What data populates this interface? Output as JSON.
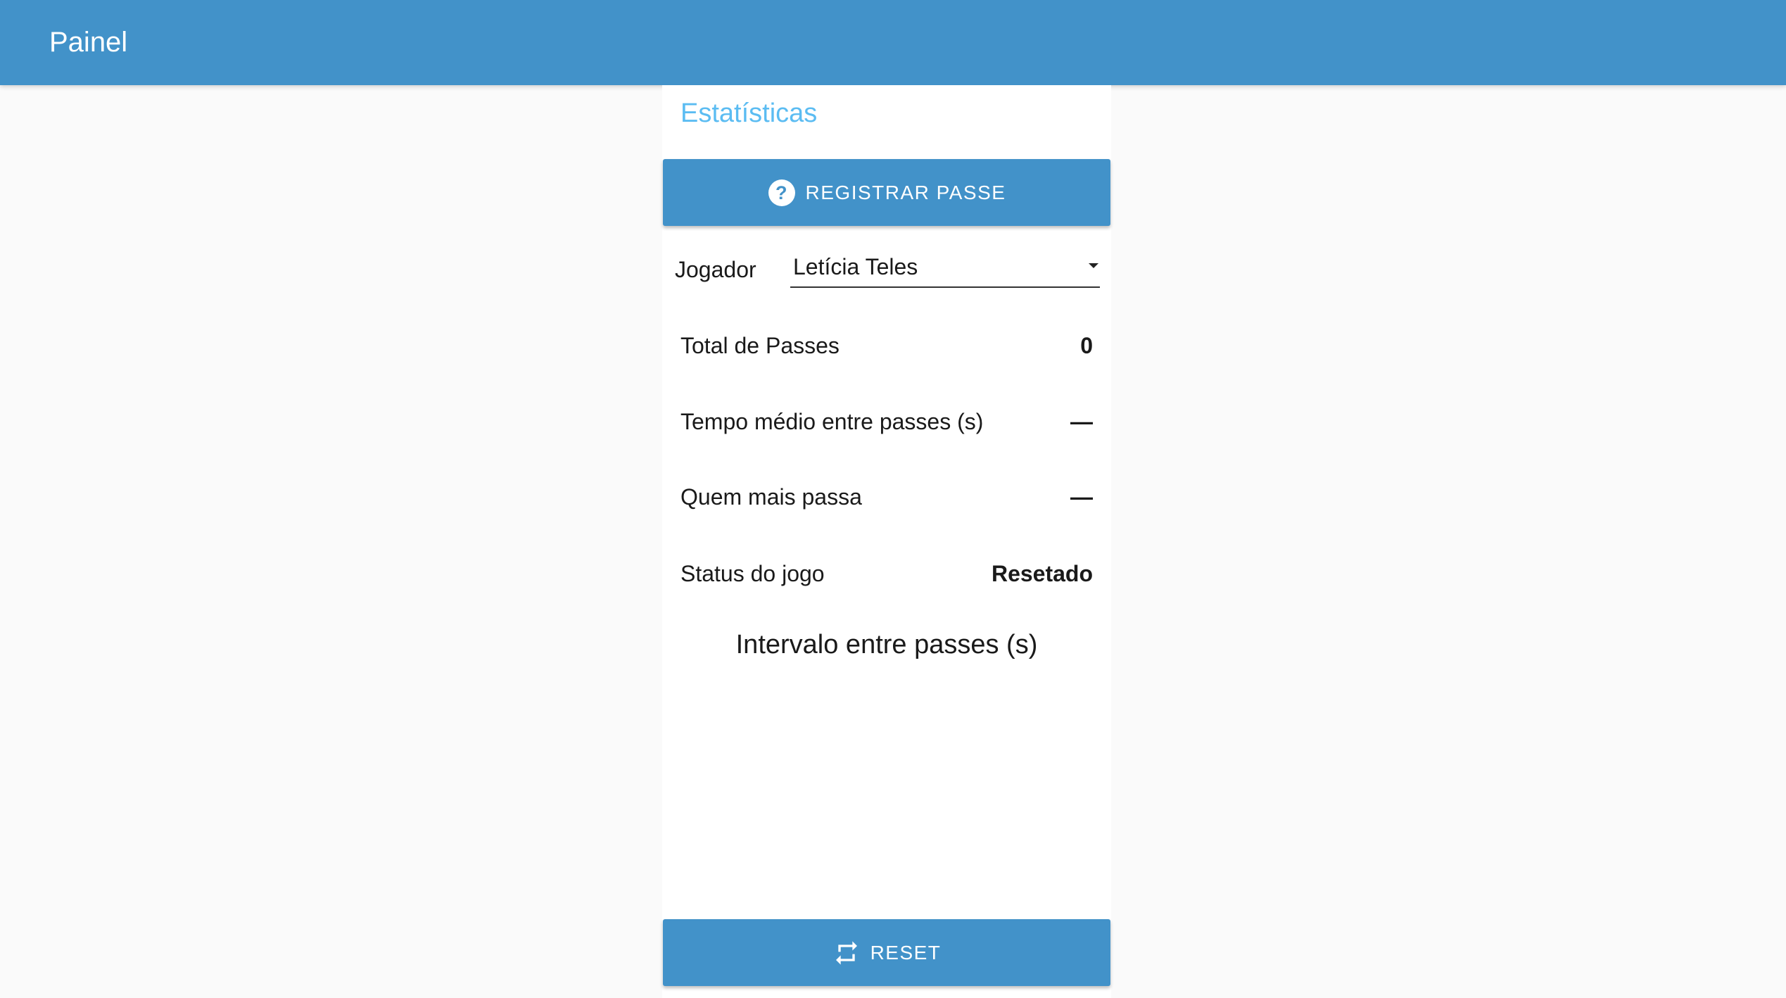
{
  "appbar": {
    "title": "Painel"
  },
  "panel": {
    "title": "Estatísticas",
    "register_button": {
      "label": "REGISTRAR PASSE",
      "icon": "help-circle-icon"
    },
    "player": {
      "label": "Jogador",
      "selected": "Letícia Teles"
    },
    "stats": [
      {
        "label": "Total de Passes",
        "value": "0"
      },
      {
        "label": "Tempo médio entre passes (s)",
        "value": "—"
      },
      {
        "label": "Quem mais passa",
        "value": "—"
      },
      {
        "label": "Status do jogo",
        "value": "Resetado"
      }
    ],
    "chart_title": "Intervalo entre passes (s)",
    "reset_button": {
      "label": "RESET",
      "icon": "repeat-icon"
    }
  },
  "colors": {
    "primary": "#4292c9",
    "accent_title": "#5bbcf2",
    "background": "#fafafa"
  }
}
